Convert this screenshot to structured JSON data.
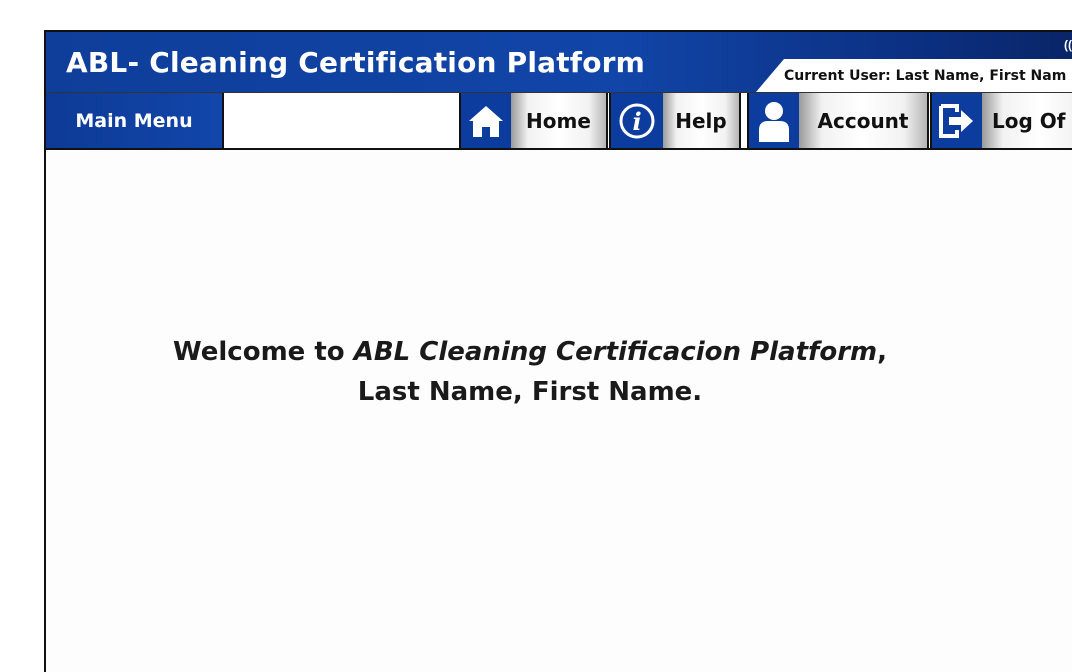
{
  "header": {
    "title": "ABL- Cleaning Certification Platform",
    "current_user": "Current User:  Last Name, First Nam",
    "colors": {
      "primary": "#0f3e9a",
      "dark": "#0a2465",
      "text": "#111111"
    }
  },
  "nav": {
    "main_menu": "Main Menu",
    "home": "Home",
    "help": "Help",
    "account": "Account",
    "logoff": "Log Of",
    "icons": [
      "home-icon",
      "info-icon",
      "user-icon",
      "logout-icon"
    ]
  },
  "welcome": {
    "prefix": "Welcome to ",
    "platform": "ABL Cleaning Certificacion Platform",
    "suffix": ",",
    "user": "Last Name, First Name."
  }
}
